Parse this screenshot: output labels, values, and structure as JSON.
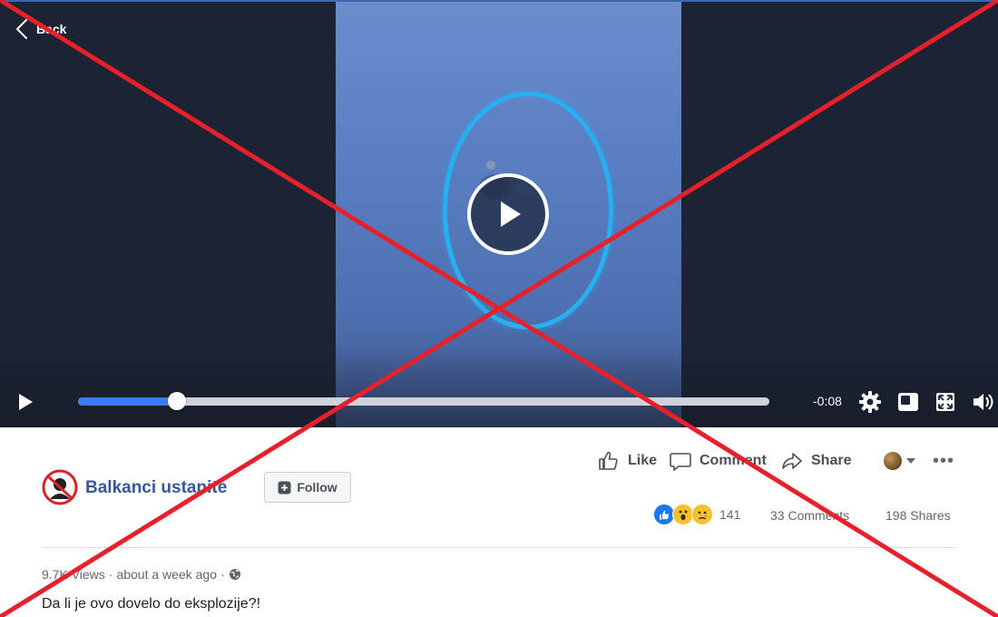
{
  "player": {
    "back_label": "Back",
    "remaining_time": "-0:08",
    "progress_fraction": 0.143,
    "accent_color": "#3b7cf4"
  },
  "post": {
    "page_name": "Balkanci ustanite",
    "follow_label": "Follow",
    "actions": {
      "like": "Like",
      "comment": "Comment",
      "share": "Share"
    },
    "reaction_count": "141",
    "comments_count": "33 Comments",
    "shares_count": "198 Shares",
    "views": "9.7K Views",
    "separator": "·",
    "posted_time": "about a week ago",
    "caption": "Da li je ovo dovelo do eksplozije?!"
  },
  "icons": [
    "back-chevron-icon",
    "play-icon",
    "settings-gear-icon",
    "pip-icon",
    "fullscreen-icon",
    "volume-icon",
    "like-thumb-icon",
    "comment-bubble-icon",
    "share-arrow-icon",
    "globe-icon",
    "follow-plus-icon"
  ],
  "overlay": {
    "x_color": "#e8202a"
  }
}
